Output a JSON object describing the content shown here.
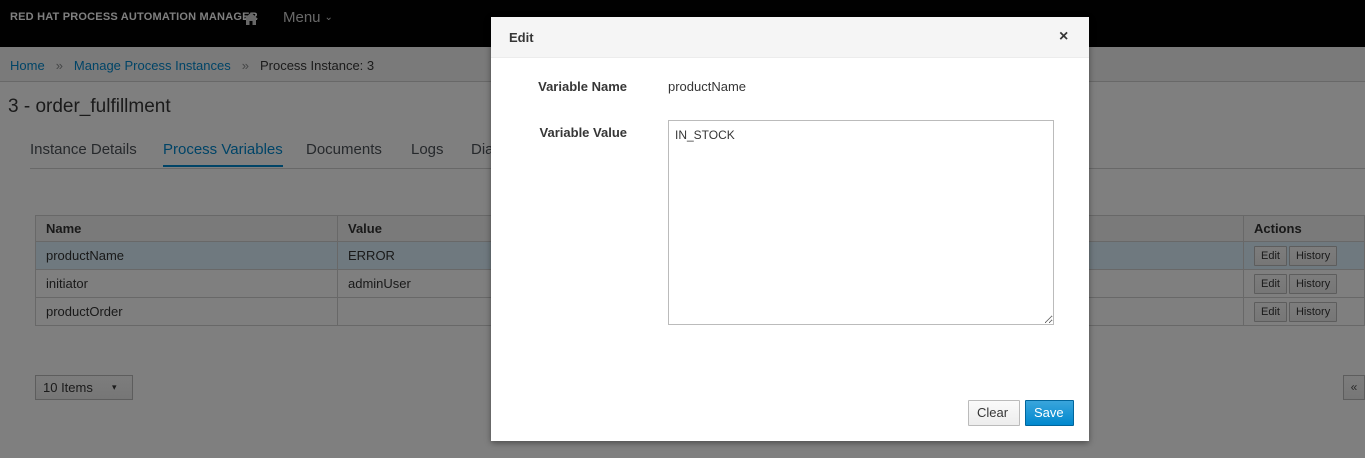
{
  "topbar": {
    "brand": "RED HAT PROCESS AUTOMATION MANAGER",
    "menu_label": "Menu",
    "home_icon": "home-icon"
  },
  "breadcrumb": {
    "home": "Home",
    "manage": "Manage Process Instances",
    "current": "Process Instance: 3",
    "separator": "»"
  },
  "page": {
    "title": "3 - order_fulfillment"
  },
  "tabs": [
    {
      "label": "Instance Details"
    },
    {
      "label": "Process Variables",
      "active": true
    },
    {
      "label": "Documents"
    },
    {
      "label": "Logs"
    },
    {
      "label": "Dia"
    }
  ],
  "table": {
    "headers": [
      "Name",
      "Value",
      "Actions"
    ],
    "rows": [
      {
        "name": "productName",
        "value": "ERROR",
        "edit": "Edit",
        "history": "History"
      },
      {
        "name": "initiator",
        "value": "adminUser",
        "edit": "Edit",
        "history": "History"
      },
      {
        "name": "productOrder",
        "value": "",
        "edit": "Edit",
        "history": "History"
      }
    ]
  },
  "pagination": {
    "items_label": "10 Items"
  },
  "modal": {
    "title": "Edit",
    "close": "×",
    "name_label": "Variable Name",
    "name_value": "productName",
    "value_label": "Variable Value",
    "value_text": "IN_STOCK",
    "clear_label": "Clear",
    "save_label": "Save"
  },
  "colors": {
    "accent": "#0088ce",
    "topbar": "#030303",
    "selected_row": "#def3ff"
  }
}
